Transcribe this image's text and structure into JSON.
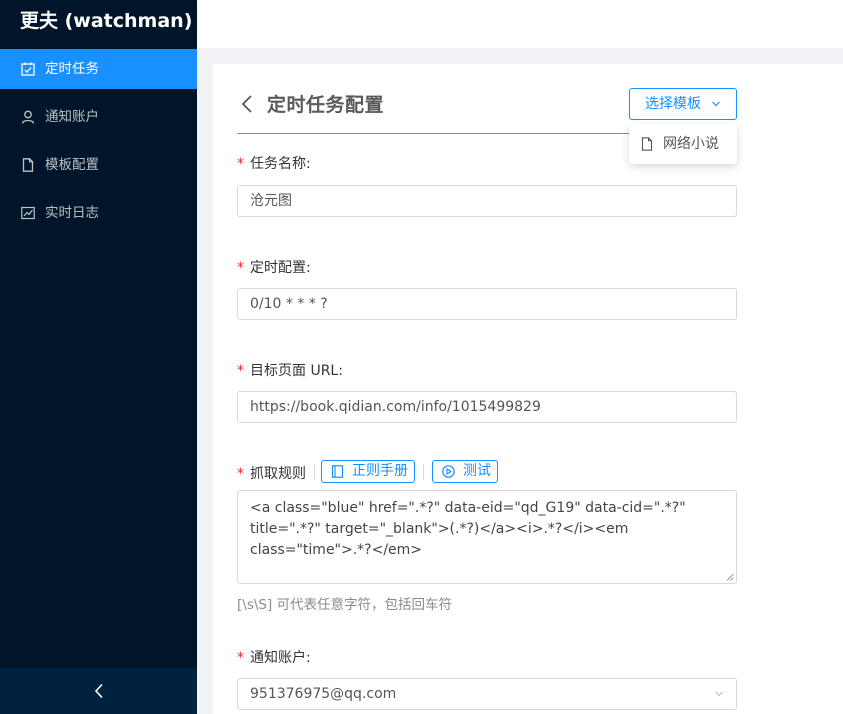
{
  "app": {
    "title": "更夫 (watchman)"
  },
  "sidebar": {
    "items": [
      {
        "label": "定时任务",
        "icon": "calendar-check-icon",
        "active": true
      },
      {
        "label": "通知账户",
        "icon": "user-icon",
        "active": false
      },
      {
        "label": "模板配置",
        "icon": "file-icon",
        "active": false
      },
      {
        "label": "实时日志",
        "icon": "line-chart-icon",
        "active": false
      }
    ],
    "collapse_icon": "chevron-left-icon"
  },
  "page": {
    "title": "定时任务配置"
  },
  "template_select": {
    "label": "选择模板",
    "options": [
      {
        "label": "网络小说",
        "icon": "file-icon"
      }
    ]
  },
  "form": {
    "task_name": {
      "label": "任务名称:",
      "value": "沧元图"
    },
    "schedule": {
      "label": "定时配置:",
      "value": "0/10 * * * ?"
    },
    "target_url": {
      "label": "目标页面 URL:",
      "value": "https://book.qidian.com/info/1015499829"
    },
    "rule": {
      "label": "抓取规则",
      "manual_button": "正则手册",
      "test_button": "测试",
      "value": "<a class=\"blue\" href=\".*?\" data-eid=\"qd_G19\" data-cid=\".*?\" title=\".*?\" target=\"_blank\">(.*?)</a><i>.*?</i><em class=\"time\">.*?</em>",
      "hint": "[\\s\\S] 可代表任意字符，包括回车符"
    },
    "notify_account": {
      "label": "通知账户:",
      "value": "951376975@qq.com"
    }
  },
  "colors": {
    "primary": "#1890ff",
    "sidebar_bg": "#001529",
    "required": "#f5222d"
  }
}
